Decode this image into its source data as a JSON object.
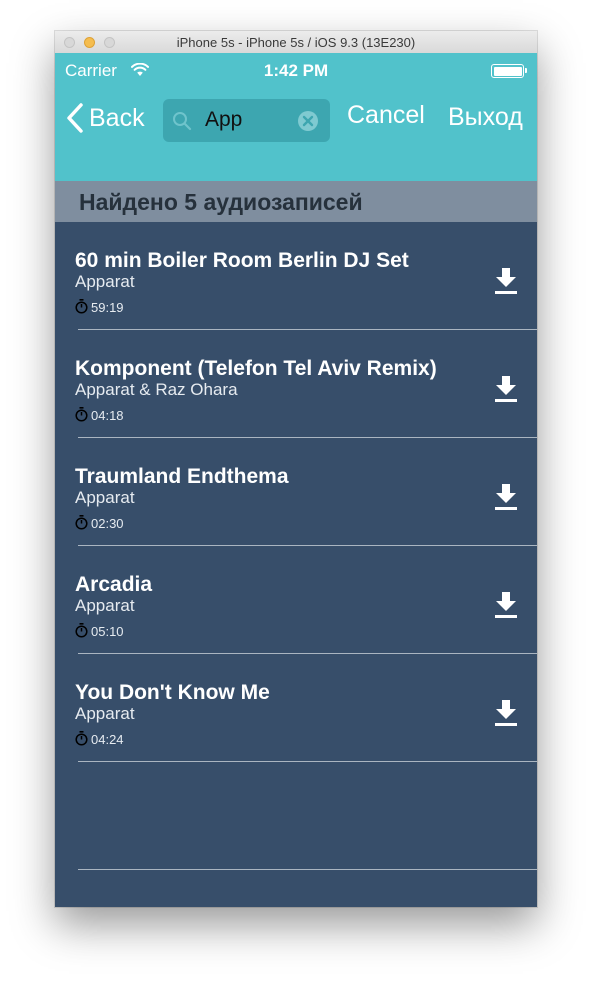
{
  "window": {
    "title": "iPhone 5s - iPhone 5s / iOS 9.3 (13E230)"
  },
  "status_bar": {
    "carrier": "Carrier",
    "time": "1:42 PM"
  },
  "nav": {
    "back_label": "Back",
    "search_value": "App",
    "cancel_label": "Cancel",
    "exit_label": "Выход"
  },
  "results": {
    "header": "Найдено 5 аудиозаписей",
    "tracks": [
      {
        "title": "60 min Boiler Room Berlin DJ Set",
        "artist": "Apparat",
        "duration": "59:19"
      },
      {
        "title": "Komponent (Telefon Tel Aviv Remix)",
        "artist": "Apparat & Raz Ohara",
        "duration": "04:18"
      },
      {
        "title": "Traumland Endthema",
        "artist": "Apparat",
        "duration": "02:30"
      },
      {
        "title": "Arcadia",
        "artist": "Apparat",
        "duration": "05:10"
      },
      {
        "title": "You Don't Know Me",
        "artist": "Apparat",
        "duration": "04:24"
      }
    ]
  },
  "colors": {
    "nav_bar": "#51c2cb",
    "background": "#374e6a",
    "section_header": "#7f8e9f"
  }
}
